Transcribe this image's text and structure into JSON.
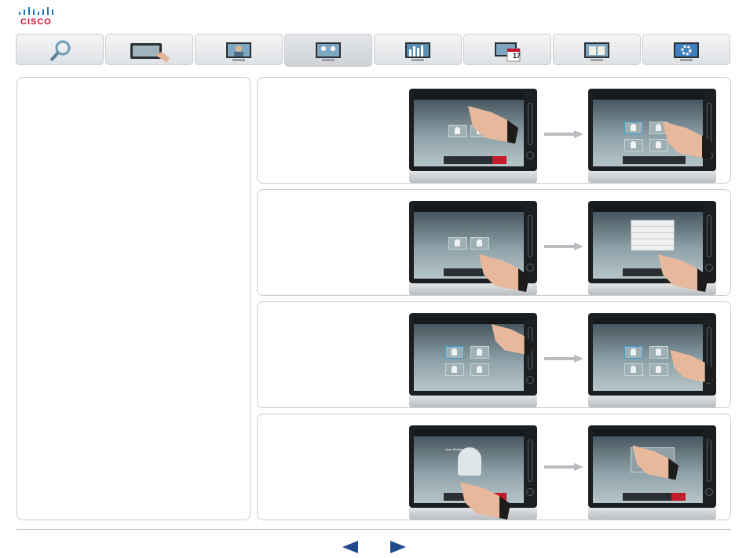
{
  "brand": {
    "name": "CISCO",
    "color": "#c8102e"
  },
  "nav_tabs": [
    {
      "icon": "search-icon"
    },
    {
      "icon": "touch-panel-icon"
    },
    {
      "icon": "video-call-icon"
    },
    {
      "icon": "conference-icon",
      "active": true
    },
    {
      "icon": "presentation-icon"
    },
    {
      "icon": "calendar-icon",
      "label": "17"
    },
    {
      "icon": "book-icon"
    },
    {
      "icon": "settings-icon"
    }
  ],
  "steps": [
    {
      "from": "participant-grid-tap",
      "to": "participant-selected"
    },
    {
      "from": "toolbar-tap",
      "to": "menu-open"
    },
    {
      "from": "status-icon-tap",
      "to": "participant-selected"
    },
    {
      "from": "call-tap",
      "to": "participant-drag"
    }
  ],
  "screen_caller": "Jane Ekdahl",
  "accent_color": "#214a8e"
}
